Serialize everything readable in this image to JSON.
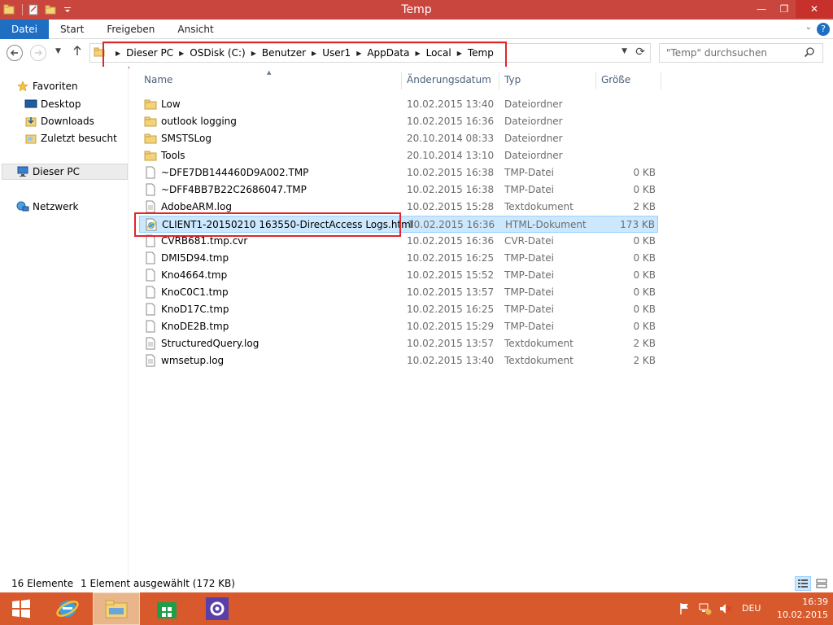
{
  "window": {
    "title": "Temp",
    "title_bar_color": "#c8463d",
    "minimize": "—",
    "maximize": "❐",
    "close": "✕"
  },
  "ribbon": {
    "tabs": [
      {
        "label": "Datei"
      },
      {
        "label": "Start"
      },
      {
        "label": "Freigeben"
      },
      {
        "label": "Ansicht"
      }
    ],
    "help": "?"
  },
  "address": {
    "breadcrumbs": [
      "Dieser PC",
      "OSDisk (C:)",
      "Benutzer",
      "User1",
      "AppData",
      "Local",
      "Temp"
    ]
  },
  "search": {
    "placeholder": "\"Temp\" durchsuchen"
  },
  "navpane": {
    "favorites": "Favoriten",
    "desktop": "Desktop",
    "downloads": "Downloads",
    "recent": "Zuletzt besucht",
    "thispc": "Dieser PC",
    "network": "Netzwerk"
  },
  "columns": {
    "name": "Name",
    "date": "Änderungsdatum",
    "type": "Typ",
    "size": "Größe"
  },
  "files": [
    {
      "name": "Low",
      "date": "10.02.2015 13:40",
      "type": "Dateiordner",
      "size": "",
      "icon": "folder-icon"
    },
    {
      "name": "outlook logging",
      "date": "10.02.2015 16:36",
      "type": "Dateiordner",
      "size": "",
      "icon": "folder-icon"
    },
    {
      "name": "SMSTSLog",
      "date": "20.10.2014 08:33",
      "type": "Dateiordner",
      "size": "",
      "icon": "folder-icon"
    },
    {
      "name": "Tools",
      "date": "20.10.2014 13:10",
      "type": "Dateiordner",
      "size": "",
      "icon": "folder-icon"
    },
    {
      "name": "~DFE7DB144460D9A002.TMP",
      "date": "10.02.2015 16:38",
      "type": "TMP-Datei",
      "size": "0 KB",
      "icon": "file-icon"
    },
    {
      "name": "~DFF4BB7B22C2686047.TMP",
      "date": "10.02.2015 16:38",
      "type": "TMP-Datei",
      "size": "0 KB",
      "icon": "file-icon"
    },
    {
      "name": "AdobeARM.log",
      "date": "10.02.2015 15:28",
      "type": "Textdokument",
      "size": "2 KB",
      "icon": "text-file-icon"
    },
    {
      "name": "CLIENT1-20150210 163550-DirectAccess Logs.html",
      "date": "10.02.2015 16:36",
      "type": "HTML-Dokument",
      "size": "173 KB",
      "icon": "html-file-icon",
      "selected": true
    },
    {
      "name": "CVRB681.tmp.cvr",
      "date": "10.02.2015 16:36",
      "type": "CVR-Datei",
      "size": "0 KB",
      "icon": "file-icon"
    },
    {
      "name": "DMI5D94.tmp",
      "date": "10.02.2015 16:25",
      "type": "TMP-Datei",
      "size": "0 KB",
      "icon": "file-icon"
    },
    {
      "name": "Kno4664.tmp",
      "date": "10.02.2015 15:52",
      "type": "TMP-Datei",
      "size": "0 KB",
      "icon": "file-icon"
    },
    {
      "name": "KnoC0C1.tmp",
      "date": "10.02.2015 13:57",
      "type": "TMP-Datei",
      "size": "0 KB",
      "icon": "file-icon"
    },
    {
      "name": "KnoD17C.tmp",
      "date": "10.02.2015 16:25",
      "type": "TMP-Datei",
      "size": "0 KB",
      "icon": "file-icon"
    },
    {
      "name": "KnoDE2B.tmp",
      "date": "10.02.2015 15:29",
      "type": "TMP-Datei",
      "size": "0 KB",
      "icon": "file-icon"
    },
    {
      "name": "StructuredQuery.log",
      "date": "10.02.2015 13:57",
      "type": "Textdokument",
      "size": "2 KB",
      "icon": "text-file-icon"
    },
    {
      "name": "wmsetup.log",
      "date": "10.02.2015 13:40",
      "type": "Textdokument",
      "size": "2 KB",
      "icon": "text-file-icon"
    }
  ],
  "status": {
    "count": "16 Elemente",
    "selection": "1 Element ausgewählt (172 KB)"
  },
  "taskbar": {
    "language": "DEU",
    "time": "16:39",
    "date": "10.02.2015",
    "color": "#d8592b"
  }
}
